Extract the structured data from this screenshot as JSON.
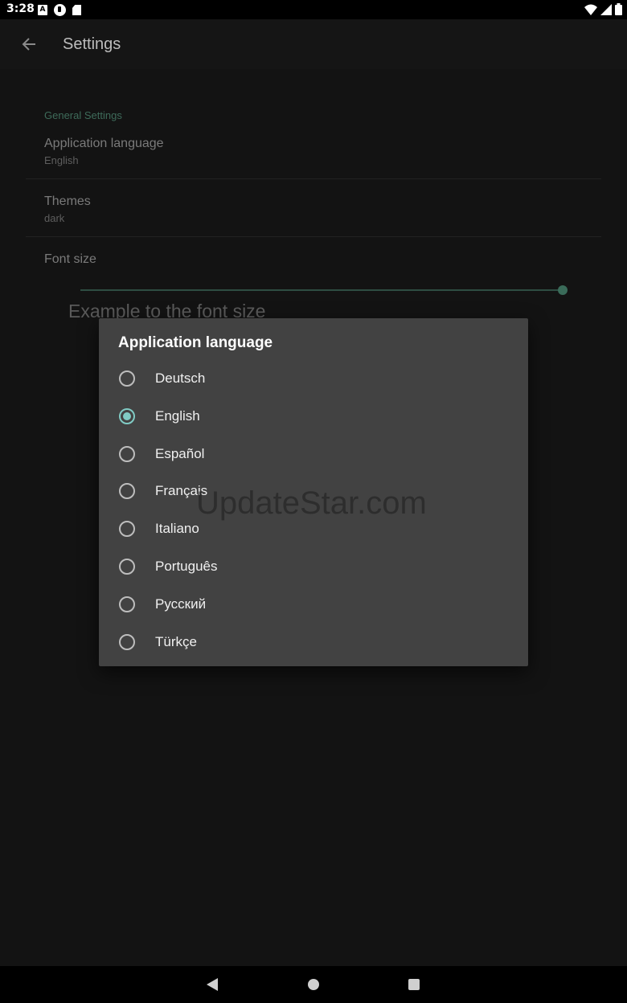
{
  "status_bar": {
    "time": "3:28",
    "notification_a": "A"
  },
  "app_bar": {
    "title": "Settings"
  },
  "settings": {
    "section_header": "General Settings",
    "language": {
      "title": "Application language",
      "summary": "English"
    },
    "themes": {
      "title": "Themes",
      "summary": "dark"
    },
    "font_size": {
      "title": "Font size",
      "slider_value_fraction": 1.0,
      "example": "Example to the font size"
    }
  },
  "dialog": {
    "title": "Application language",
    "options": [
      {
        "label": "Deutsch",
        "checked": false
      },
      {
        "label": "English",
        "checked": true
      },
      {
        "label": "Español",
        "checked": false
      },
      {
        "label": "Français",
        "checked": false
      },
      {
        "label": "Italiano",
        "checked": false
      },
      {
        "label": "Português",
        "checked": false
      },
      {
        "label": "Русский",
        "checked": false
      },
      {
        "label": "Türkçe",
        "checked": false
      }
    ]
  },
  "watermark": "UpdateStar.com",
  "colors": {
    "accent": "#80cbc4",
    "dialog_bg": "#424242",
    "background": "#131313"
  }
}
